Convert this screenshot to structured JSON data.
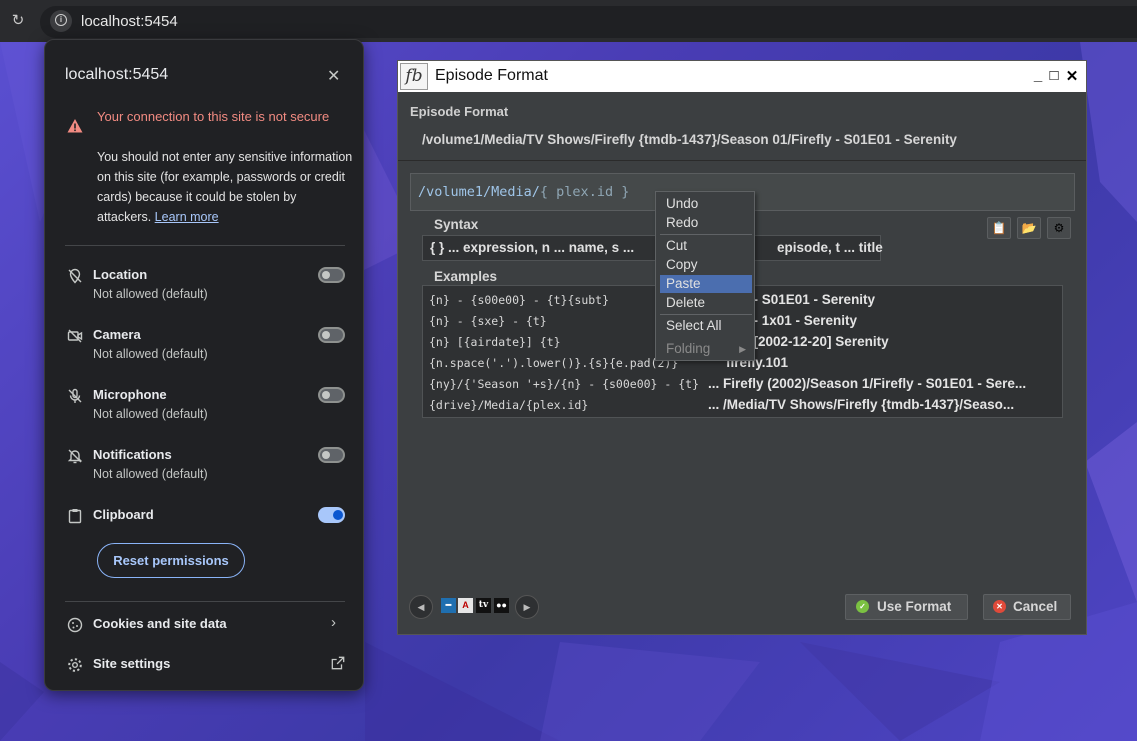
{
  "browser": {
    "url": "localhost:5454"
  },
  "site_popup": {
    "title": "localhost:5454",
    "warning_title": "Your connection to this site is not secure",
    "warning_body": "You should not enter any sensitive information on this site (for example, passwords or credit cards) because it could be stolen by attackers.",
    "learn_more": "Learn more",
    "permissions": [
      {
        "label": "Location",
        "status": "Not allowed (default)",
        "enabled": false,
        "icon": "location-off-icon"
      },
      {
        "label": "Camera",
        "status": "Not allowed (default)",
        "enabled": false,
        "icon": "camera-off-icon"
      },
      {
        "label": "Microphone",
        "status": "Not allowed (default)",
        "enabled": false,
        "icon": "microphone-off-icon"
      },
      {
        "label": "Notifications",
        "status": "Not allowed (default)",
        "enabled": false,
        "icon": "bell-off-icon"
      },
      {
        "label": "Clipboard",
        "status": "",
        "enabled": true,
        "icon": "clipboard-icon"
      }
    ],
    "reset_label": "Reset permissions",
    "cookies_label": "Cookies and site data",
    "site_settings_label": "Site settings"
  },
  "episode_window": {
    "title": "Episode Format",
    "subtitle": "Episode Format",
    "preview_path": "/volume1/Media/TV Shows/Firefly {tmdb-1437}/Season 01/Firefly - S01E01 - Serenity",
    "expression_prefix": "/volume1/Media/",
    "expression_suffix": "{ plex.id }",
    "syntax_label": "Syntax",
    "syntax_text_left": "{ } ... expression, n ... name, s ...",
    "syntax_text_right": "episode, t ... title",
    "examples_label": "Examples",
    "examples": [
      {
        "format": "{n} - {s00e00} - {t}{subt}",
        "result": "fly - S01E01 - Serenity"
      },
      {
        "format": "{n} - {sxe} - {t}",
        "result": "fly - 1x01 - Serenity"
      },
      {
        "format": "{n} [{airdate}] {t}",
        "result": "fly [2002-12-20] Serenity"
      },
      {
        "format": "{n.space('.').lower()}.{s}{e.pad(2)}",
        "result": "firefly.101"
      },
      {
        "format": "{ny}/{'Season '+s}/{n} - {s00e00} - {t}",
        "result": "... Firefly (2002)/Season 1/Firefly - S01E01 - Sere..."
      },
      {
        "format": "{drive}/Media/{plex.id}",
        "result": "... /Media/TV Shows/Firefly {tmdb-1437}/Seaso..."
      }
    ],
    "use_format_label": "Use Format",
    "cancel_label": "Cancel"
  },
  "context_menu": {
    "items": [
      "Undo",
      "Redo",
      "Cut",
      "Copy",
      "Paste",
      "Delete",
      "Select All",
      "Folding"
    ],
    "selected": "Paste",
    "disabled": [
      "Folding"
    ]
  },
  "colors": {
    "accent_link": "#a8c7fa",
    "warning": "#f28b82",
    "menu_selection": "#4b6eaf"
  }
}
